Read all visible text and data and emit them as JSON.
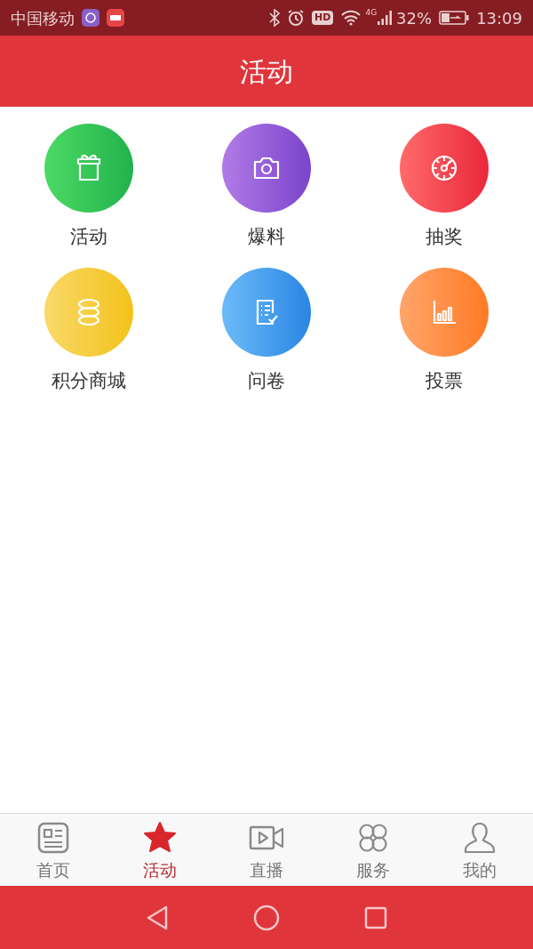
{
  "status_bar": {
    "carrier": "中国移动",
    "hd": "HD",
    "network": "4G",
    "battery": "32%",
    "time": "13:09"
  },
  "header": {
    "title": "活动"
  },
  "grid": [
    {
      "label": "活动",
      "kind": "gift"
    },
    {
      "label": "爆料",
      "kind": "camera"
    },
    {
      "label": "抽奖",
      "kind": "wheel"
    },
    {
      "label": "积分商城",
      "kind": "coins"
    },
    {
      "label": "问卷",
      "kind": "survey"
    },
    {
      "label": "投票",
      "kind": "chart"
    }
  ],
  "tabs": [
    {
      "label": "首页",
      "kind": "news",
      "selected": false
    },
    {
      "label": "活动",
      "kind": "star",
      "selected": true
    },
    {
      "label": "直播",
      "kind": "video",
      "selected": false
    },
    {
      "label": "服务",
      "kind": "clover",
      "selected": false
    },
    {
      "label": "我的",
      "kind": "person",
      "selected": false
    }
  ]
}
